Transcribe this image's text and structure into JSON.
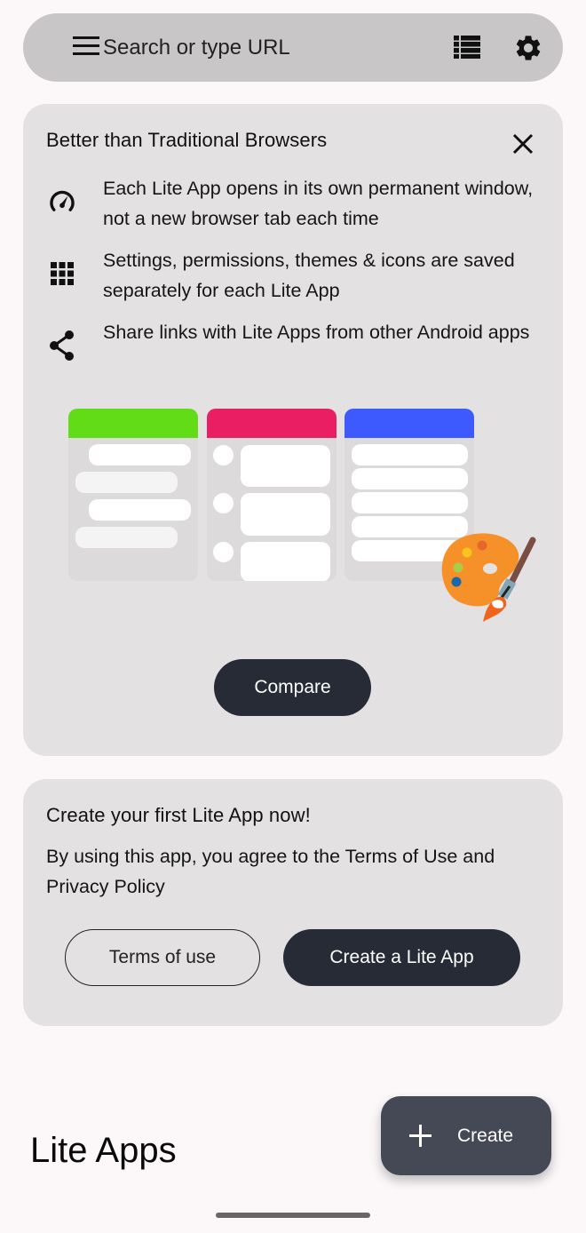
{
  "searchbar": {
    "menu_icon": "hamburger-menu-icon",
    "placeholder": "Search or type URL",
    "value": "",
    "list_view_icon": "list-view-icon",
    "settings_icon": "gear-icon"
  },
  "features_card": {
    "title": "Better than Traditional Browsers",
    "close_icon": "close-icon",
    "items": [
      {
        "icon": "speedometer-icon",
        "text": "Each Lite App opens in its own permanent window, not a new browser tab each time"
      },
      {
        "icon": "grid-apps-icon",
        "text": "Settings, permissions, themes & icons are saved separately for each Lite App"
      },
      {
        "icon": "share-icon",
        "text": "Share links with Lite Apps from other Android apps"
      }
    ],
    "illustration": {
      "panel_colors": [
        "#62dc16",
        "#e91e63",
        "#3d5afe"
      ],
      "palette_icon": "artist-palette-icon"
    },
    "compare_label": "Compare"
  },
  "create_card": {
    "title": "Create your first Lite App now!",
    "description": "By using this app, you agree to the Terms of Use and Privacy Policy",
    "terms_label": "Terms of use",
    "create_label": "Create a Lite App"
  },
  "section": {
    "title": "Lite Apps"
  },
  "fab": {
    "icon": "plus-icon",
    "label": "Create"
  },
  "colors": {
    "background": "#fcf8f9",
    "card": "#e3e1e2",
    "searchbar": "#c8c6c7",
    "dark_button": "#272b36",
    "fab": "#454956"
  }
}
